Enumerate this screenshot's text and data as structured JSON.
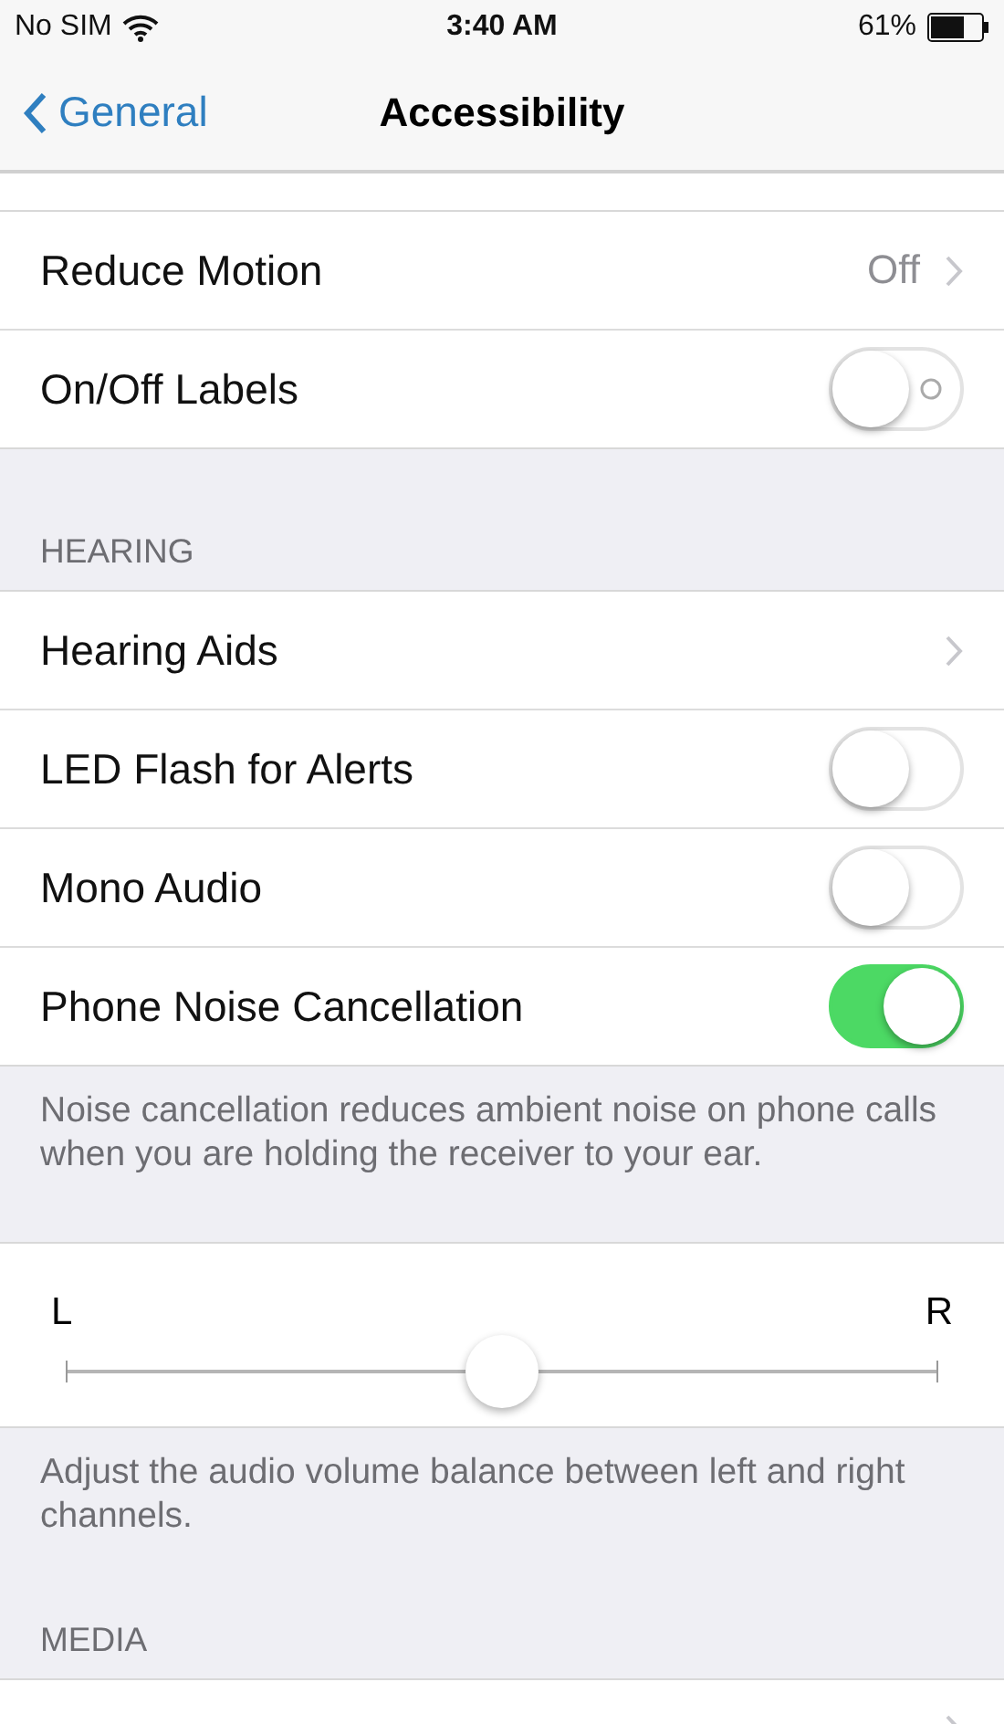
{
  "status_bar": {
    "carrier": "No SIM",
    "time": "3:40 AM",
    "battery": "61%"
  },
  "nav": {
    "back": "General",
    "title": "Accessibility"
  },
  "sections": [
    {
      "kind": "list",
      "rows": [
        {
          "kind": "detail",
          "label": "Reduce Motion",
          "value": "Off"
        },
        {
          "kind": "toggle",
          "label": "On/Off Labels",
          "on": false,
          "show_label": true
        }
      ]
    },
    {
      "kind": "list",
      "header": "HEARING",
      "rows": [
        {
          "kind": "detail",
          "label": "Hearing Aids"
        },
        {
          "kind": "toggle",
          "label": "LED Flash for Alerts",
          "on": false,
          "show_label": false
        },
        {
          "kind": "toggle",
          "label": "Mono Audio",
          "on": false,
          "show_label": false
        },
        {
          "kind": "toggle",
          "label": "Phone Noise Cancellation",
          "on": true,
          "show_label": false
        }
      ],
      "footer": "Noise cancellation reduces ambient noise on phone calls when you are holding the receiver to your ear."
    },
    {
      "kind": "balance",
      "left": "L",
      "right": "R",
      "level": 0.5,
      "footer": "Adjust the audio volume balance between left and right channels."
    },
    {
      "kind": "list",
      "header": "MEDIA",
      "rows": [
        {
          "kind": "partial"
        }
      ]
    }
  ]
}
